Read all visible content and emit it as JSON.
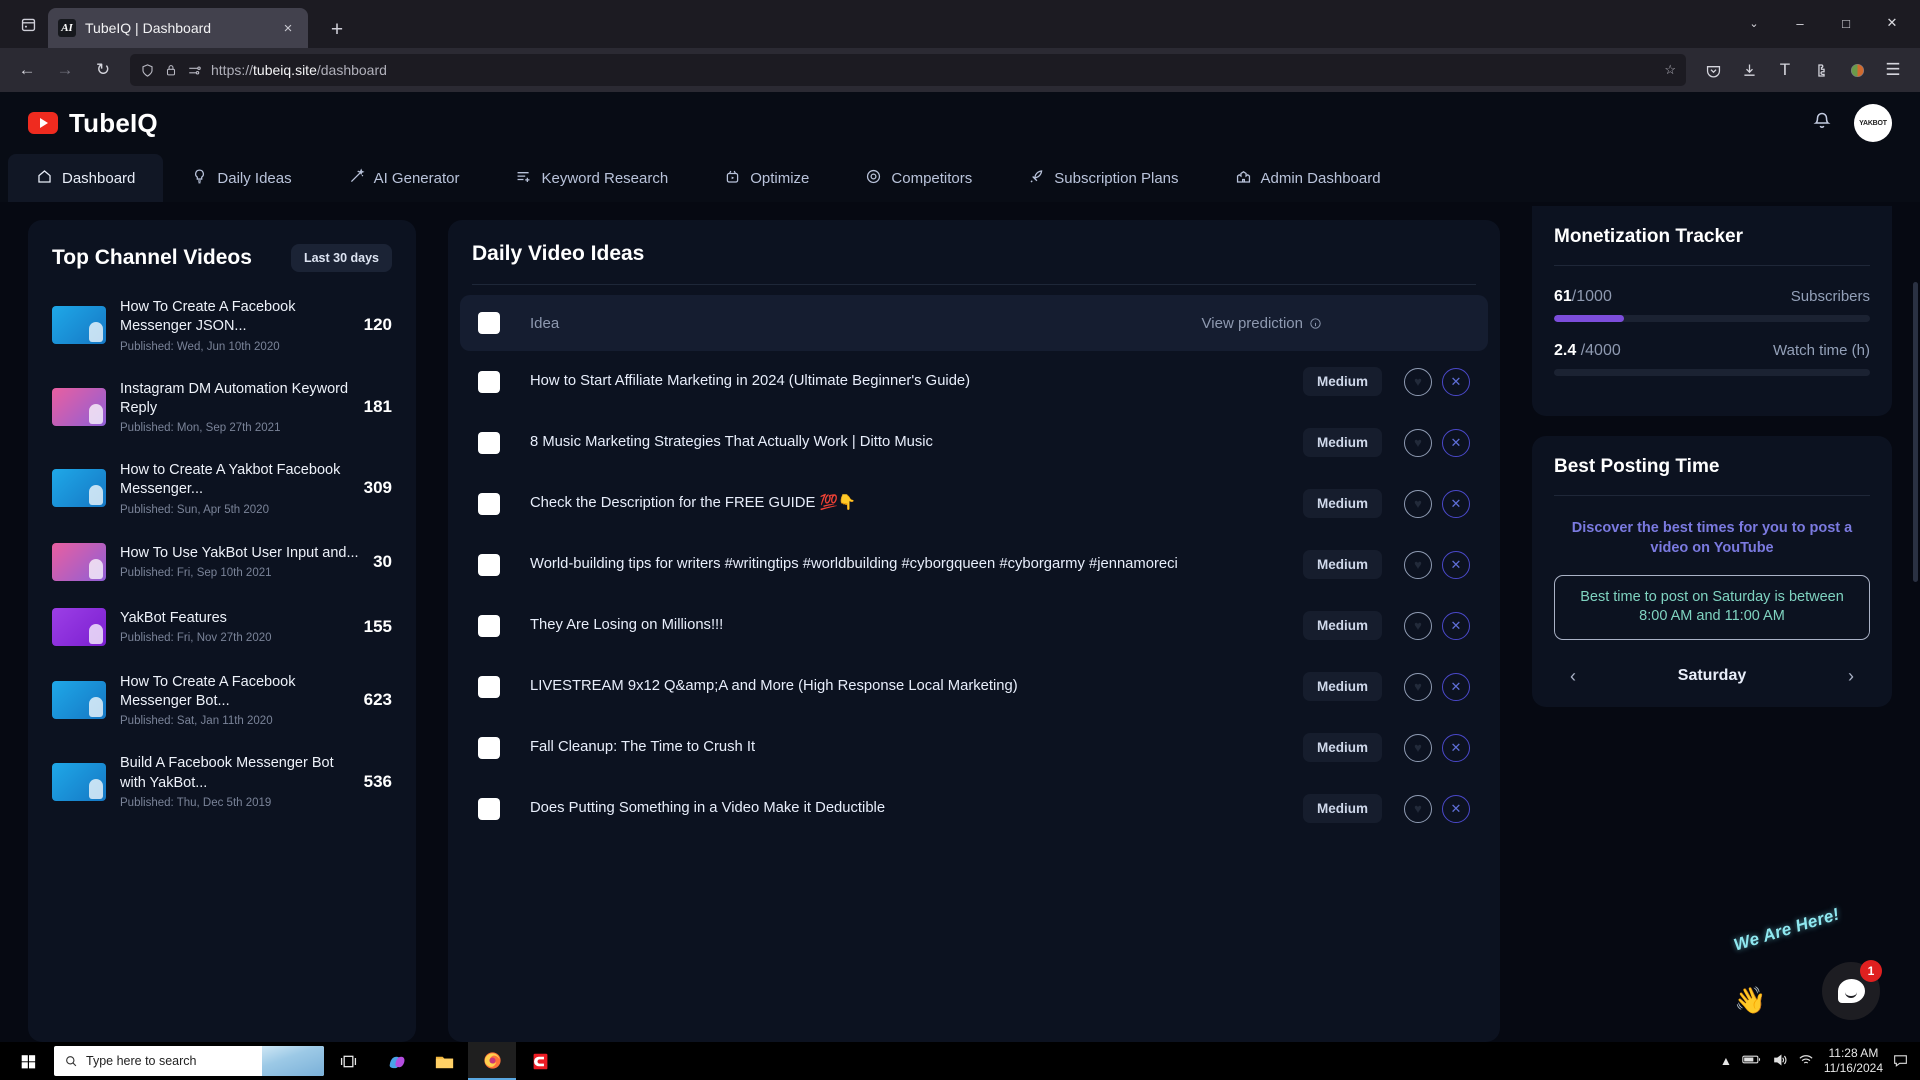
{
  "browser": {
    "tab": {
      "title": "TubeIQ | Dashboard",
      "favicon_text": "AI"
    },
    "new_tab_label": "+",
    "close_label": "×",
    "url_scheme": "https://",
    "url_domain": "tubeiq.site",
    "url_path": "/dashboard",
    "icons": {
      "list_all_tabs": "list-all-tabs-icon",
      "back": "←",
      "forward": "→",
      "reload": "↻",
      "shield": "shield-icon",
      "lock": "lock-icon",
      "perms": "permissions-icon",
      "bookmark": "☆",
      "pocket": "pocket-icon",
      "downloads": "download-icon",
      "account": "T",
      "extensions": "extensions-icon",
      "container": "container-icon",
      "menu": "☰",
      "win_chevron": "⌄",
      "win_min": "–",
      "win_max": "□",
      "win_close": "✕"
    }
  },
  "app": {
    "brand": "TubeIQ",
    "avatar_label": "YAKBOT",
    "bell": "bell-icon",
    "nav": [
      {
        "label": "Dashboard",
        "icon": "home-icon",
        "active": true
      },
      {
        "label": "Daily Ideas",
        "icon": "lightbulb-icon",
        "active": false
      },
      {
        "label": "AI Generator",
        "icon": "magic-wand-icon",
        "active": false
      },
      {
        "label": "Keyword Research",
        "icon": "list-plus-icon",
        "active": false
      },
      {
        "label": "Optimize",
        "icon": "video-box-icon",
        "active": false
      },
      {
        "label": "Competitors",
        "icon": "target-icon",
        "active": false
      },
      {
        "label": "Subscription Plans",
        "icon": "rocket-icon",
        "active": false
      },
      {
        "label": "Admin Dashboard",
        "icon": "castle-icon",
        "active": false
      }
    ]
  },
  "top_channel_videos": {
    "title": "Top Channel Videos",
    "period_badge": "Last 30 days",
    "items": [
      {
        "title": "How To Create A Facebook Messenger JSON...",
        "published": "Published: Wed, Jun 10th 2020",
        "count": "120",
        "thumb": "t-blue"
      },
      {
        "title": "Instagram DM Automation Keyword Reply",
        "published": "Published: Mon, Sep 27th 2021",
        "count": "181",
        "thumb": "t-pink"
      },
      {
        "title": "How to Create A Yakbot Facebook Messenger...",
        "published": "Published: Sun, Apr 5th 2020",
        "count": "309",
        "thumb": "t-blue"
      },
      {
        "title": "How To Use YakBot User Input and...",
        "published": "Published: Fri, Sep 10th 2021",
        "count": "30",
        "thumb": "t-pink"
      },
      {
        "title": "YakBot Features",
        "published": "Published: Fri, Nov 27th 2020",
        "count": "155",
        "thumb": "t-purple"
      },
      {
        "title": "How To Create A Facebook Messenger Bot...",
        "published": "Published: Sat, Jan 11th 2020",
        "count": "623",
        "thumb": "t-blue"
      },
      {
        "title": "Build A Facebook Messenger Bot with YakBot...",
        "published": "Published: Thu, Dec 5th 2019",
        "count": "536",
        "thumb": "t-blue"
      }
    ]
  },
  "daily_video_ideas": {
    "title": "Daily Video Ideas",
    "columns": {
      "idea": "Idea",
      "prediction": "View prediction"
    },
    "rows": [
      {
        "idea": "How to Start Affiliate Marketing in 2024 (Ultimate Beginner's Guide)",
        "prediction": "Medium"
      },
      {
        "idea": "8 Music Marketing Strategies That Actually Work | Ditto Music",
        "prediction": "Medium"
      },
      {
        "idea": "Check the Description for the FREE GUIDE 💯👇",
        "prediction": "Medium"
      },
      {
        "idea": "World-building tips for writers #writingtips #worldbuilding #cyborgqueen #cyborgarmy #jennamoreci",
        "prediction": "Medium"
      },
      {
        "idea": "They Are Losing on Millions!!!",
        "prediction": "Medium"
      },
      {
        "idea": "LIVESTREAM 9x12 Q&amp;A and More (High Response Local Marketing)",
        "prediction": "Medium"
      },
      {
        "idea": "Fall Cleanup: The Time to Crush It",
        "prediction": "Medium"
      },
      {
        "idea": "Does Putting Something in a Video Make it Deductible",
        "prediction": "Medium"
      }
    ],
    "action_icons": {
      "like": "heart-icon",
      "dismiss": "close-icon"
    }
  },
  "monetization_tracker": {
    "title": "Monetization Tracker",
    "subscribers": {
      "current": "61",
      "target": "/1000",
      "label": "Subscribers",
      "percent": 22
    },
    "watch_time": {
      "current": "2.4",
      "target": "/4000",
      "label": "Watch time (h)",
      "percent": 0
    },
    "bar_color": "#7c4ddb"
  },
  "best_posting_time": {
    "title": "Best Posting Time",
    "subtitle": "Discover the best times for you to post a video on YouTube",
    "recommendation": "Best time to post on Saturday is between 8:00 AM and 11:00 AM",
    "day": "Saturday",
    "prev_arrow": "‹",
    "next_arrow": "›"
  },
  "chat_widget": {
    "label": "We Are Here!",
    "wave_emoji": "👋",
    "badge_count": "1"
  },
  "taskbar": {
    "search_placeholder": "Type here to search",
    "time": "11:28 AM",
    "date": "11/16/2024",
    "icons": [
      "task-view-icon",
      "copilot-icon",
      "file-explorer-icon",
      "firefox-icon",
      "camtasia-icon"
    ],
    "tray": [
      "show-hidden-icons",
      "battery-icon",
      "volume-icon",
      "network-icon",
      "action-center-icon"
    ]
  }
}
